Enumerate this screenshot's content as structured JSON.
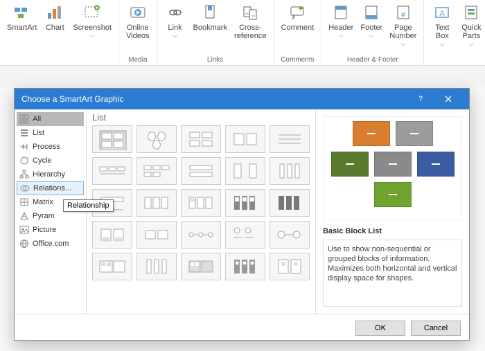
{
  "ribbon": {
    "groups": [
      {
        "label": "",
        "items": [
          {
            "name": "smartart",
            "label": "SmartArt"
          },
          {
            "name": "chart",
            "label": "Chart"
          },
          {
            "name": "screenshot",
            "label": "Screenshot",
            "dd": true
          }
        ]
      },
      {
        "label": "Media",
        "items": [
          {
            "name": "online-videos",
            "label": "Online\nVideos"
          }
        ]
      },
      {
        "label": "Links",
        "items": [
          {
            "name": "link",
            "label": "Link",
            "dd": true
          },
          {
            "name": "bookmark",
            "label": "Bookmark"
          },
          {
            "name": "cross-reference",
            "label": "Cross-\nreference"
          }
        ]
      },
      {
        "label": "Comments",
        "items": [
          {
            "name": "comment",
            "label": "Comment"
          }
        ]
      },
      {
        "label": "Header & Footer",
        "items": [
          {
            "name": "header",
            "label": "Header",
            "dd": true
          },
          {
            "name": "footer",
            "label": "Footer",
            "dd": true
          },
          {
            "name": "page-number",
            "label": "Page\nNumber",
            "dd": true
          }
        ]
      },
      {
        "label": "",
        "items": [
          {
            "name": "text-box",
            "label": "Text\nBox",
            "dd": true
          },
          {
            "name": "quick-parts",
            "label": "Quick\nParts",
            "dd": true
          }
        ]
      }
    ]
  },
  "dialog": {
    "title": "Choose a SmartArt Graphic",
    "nav": [
      {
        "name": "all",
        "label": "All",
        "sel": true
      },
      {
        "name": "list",
        "label": "List"
      },
      {
        "name": "process",
        "label": "Process"
      },
      {
        "name": "cycle",
        "label": "Cycle"
      },
      {
        "name": "hierarchy",
        "label": "Hierarchy"
      },
      {
        "name": "relationship",
        "label": "Relations...",
        "hl": true
      },
      {
        "name": "matrix",
        "label": "Matrix"
      },
      {
        "name": "pyramid",
        "label": "Pyram"
      },
      {
        "name": "picture",
        "label": "Picture"
      },
      {
        "name": "officecom",
        "label": "Office.com"
      }
    ],
    "tooltip": "Relationship",
    "gallery_header": "List",
    "preview": {
      "name": "Basic Block List",
      "desc": "Use to show non-sequential or grouped blocks of information. Maximizes both horizontal and vertical display space for shapes.",
      "colors": [
        "#d97e2e",
        "#9c9c9c",
        "#5a7a2e",
        "#8a8a8a",
        "#3b5ca0",
        "#6ea32e"
      ]
    },
    "buttons": {
      "ok": "OK",
      "cancel": "Cancel"
    }
  }
}
